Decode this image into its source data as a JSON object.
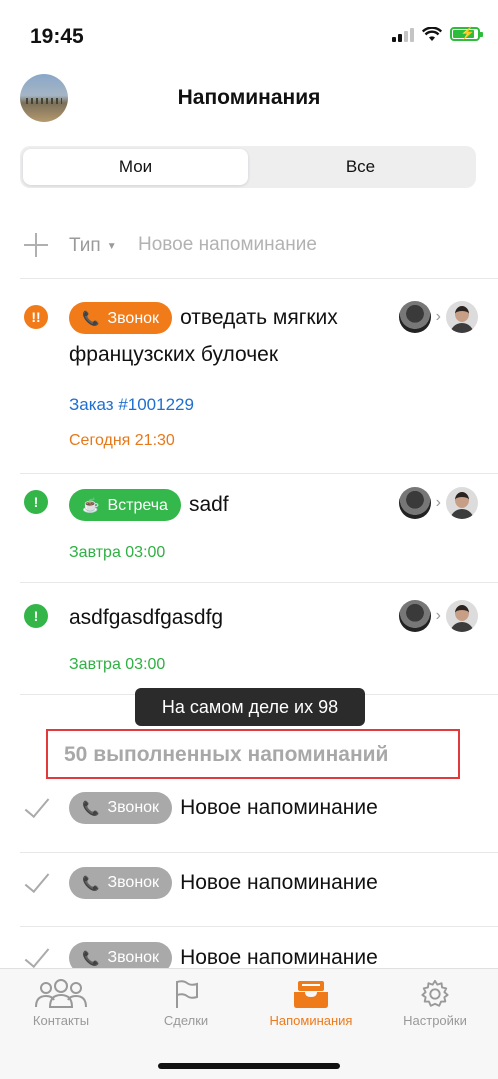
{
  "status": {
    "time": "19:45"
  },
  "header": {
    "title": "Напоминания"
  },
  "segments": {
    "mine": "Мои",
    "all": "Все"
  },
  "new_reminder": {
    "type_label": "Тип",
    "placeholder": "Новое напоминание"
  },
  "reminders": [
    {
      "priority": "!!",
      "tag": "Звонок",
      "text": "отведать мягких французских булочек",
      "order": "Заказ #1001229",
      "date": "Сегодня 21:30"
    },
    {
      "priority": "!",
      "tag": "Встреча",
      "text": "sadf",
      "date": "Завтра 03:00"
    },
    {
      "priority": "!",
      "text": "asdfgasdfgasdfg",
      "date": "Завтра 03:00"
    }
  ],
  "tooltip": "На самом деле их 98",
  "completed_label": "50 выполненных напоминаний",
  "completed_items": [
    {
      "tag": "Звонок",
      "text": "Новое напоминание"
    },
    {
      "tag": "Звонок",
      "text": "Новое напоминание"
    },
    {
      "tag": "Звонок",
      "text": "Новое напоминание"
    }
  ],
  "tabbar": {
    "contacts": "Контакты",
    "deals": "Сделки",
    "reminders": "Напоминания",
    "settings": "Настройки"
  },
  "colors": {
    "accent": "#f07b18",
    "green": "#33b548",
    "highlight": "#e23a3a"
  }
}
